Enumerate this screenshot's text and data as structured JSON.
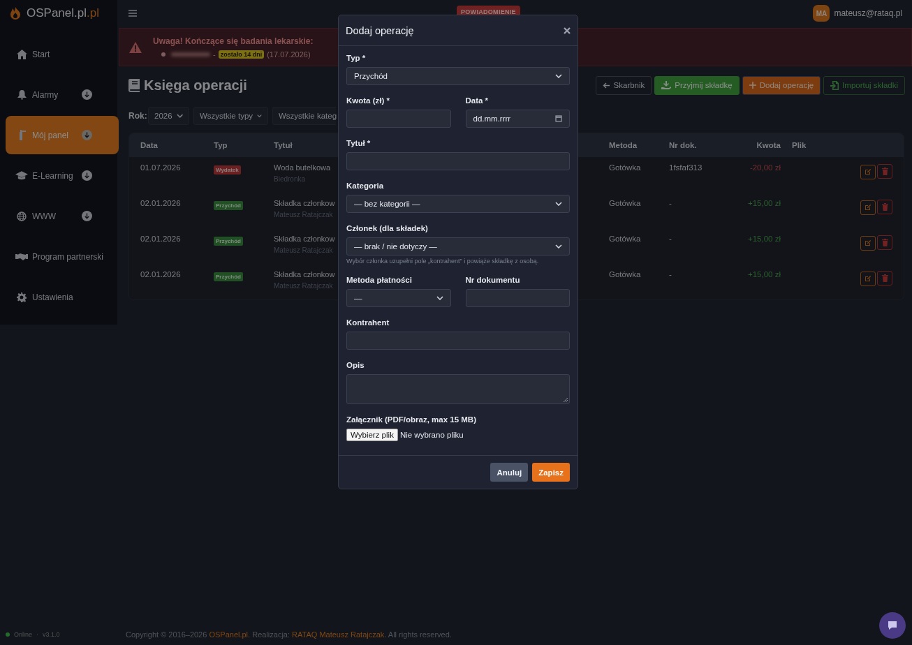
{
  "brand": {
    "name": "OSPanel.pl",
    "suffix": ".pl"
  },
  "sidebar": {
    "items": [
      {
        "label": "Start",
        "has_submenu": false,
        "selected": false
      },
      {
        "label": "Alarmy",
        "has_submenu": true,
        "selected": false
      },
      {
        "label": "Mój panel",
        "has_submenu": true,
        "selected": true
      },
      {
        "label": "E-Learning",
        "has_submenu": true,
        "selected": false
      },
      {
        "label": "WWW",
        "has_submenu": true,
        "selected": false
      },
      {
        "label": "Program partnerski",
        "has_submenu": false,
        "selected": false
      },
      {
        "label": "Ustawienia",
        "has_submenu": false,
        "selected": false
      }
    ],
    "status": "Online",
    "separator": "·",
    "version": "v3.1.0"
  },
  "topbar": {
    "notification": "POWIADOMIENIE",
    "user": {
      "initials": "MA",
      "email": "mateusz@rataq.pl"
    }
  },
  "alert": {
    "title": "Uwaga! Kończące się badania lekarskie:",
    "items": [
      {
        "separator": "-",
        "badge": "zostało 14 dni",
        "date": "(17.07.2026)"
      }
    ]
  },
  "page": {
    "title": "Księga operacji",
    "actions": [
      {
        "label": "Skarbnik",
        "kind": "back"
      },
      {
        "label": "Przyjmij składkę",
        "kind": "success"
      },
      {
        "label": "Dodaj operację",
        "kind": "primary"
      },
      {
        "label": "Importuj składki",
        "kind": "import"
      }
    ]
  },
  "filters": {
    "label": "Rok:",
    "selects": [
      "2026",
      "Wszystkie typy",
      "Wszystkie kateg"
    ]
  },
  "table": {
    "columns": [
      "Data",
      "Typ",
      "Tytuł",
      "Metoda",
      "Nr dok.",
      "Kwota",
      "Plik"
    ],
    "rows": [
      {
        "date": "01.07.2026",
        "type": {
          "label": "Wydatek",
          "kind": "expense"
        },
        "title": "Woda butelkowa",
        "subtitle": "Biedronka",
        "method": "Gotówka",
        "doc": "1fsfaf313",
        "amount": "-20,00 zł"
      },
      {
        "date": "02.01.2026",
        "type": {
          "label": "Przychód",
          "kind": "income"
        },
        "title": "Składka członkow",
        "subtitle": "Mateusz Ratajczak",
        "method": "Gotówka",
        "doc": "-",
        "amount": "+15,00 zł"
      },
      {
        "date": "02.01.2026",
        "type": {
          "label": "Przychód",
          "kind": "income"
        },
        "title": "Składka członkow",
        "subtitle": "Mateusz Ratajczak",
        "method": "Gotówka",
        "doc": "-",
        "amount": "+15,00 zł"
      },
      {
        "date": "02.01.2026",
        "type": {
          "label": "Przychód",
          "kind": "income"
        },
        "title": "Składka członkow",
        "subtitle": "Mateusz Ratajczak",
        "method": "Gotówka",
        "doc": "-",
        "amount": "+15,00 zł"
      }
    ]
  },
  "footer": {
    "copyright": "Copyright © 2016–2026",
    "link1": "OSPanel.pl",
    "middle": ". Realizacja:",
    "link2": "RATAQ Mateusz Ratajczak",
    "end": ". All rights reserved."
  },
  "modal": {
    "title": "Dodaj operację",
    "rows": [
      [
        {
          "kind": "select",
          "label": "Typ *",
          "value": "Przychód"
        }
      ],
      [
        {
          "kind": "input",
          "label": "Kwota (zł) *"
        },
        {
          "kind": "date",
          "label": "Data *",
          "placeholder": "dd.mm.rrrr"
        }
      ],
      [
        {
          "kind": "input",
          "label": "Tytuł *"
        }
      ],
      [
        {
          "kind": "select",
          "label": "Kategoria",
          "value": "— bez kategorii —"
        }
      ],
      [
        {
          "kind": "select",
          "label": "Członek (dla składek)",
          "value": "— brak / nie dotyczy —",
          "hint": "Wybór członka uzupełni pole „kontrahent\" i powiąże składkę z osobą."
        }
      ],
      [
        {
          "kind": "select",
          "label": "Metoda płatności",
          "value": "—"
        },
        {
          "kind": "input",
          "label": "Nr dokumentu"
        }
      ],
      [
        {
          "kind": "input",
          "label": "Kontrahent"
        }
      ],
      [
        {
          "kind": "textarea",
          "label": "Opis"
        }
      ],
      [
        {
          "kind": "file",
          "label": "Załącznik (PDF/obraz, max 15 MB)",
          "button": "Wybierz plik",
          "status": "Nie wybrano pliku"
        }
      ]
    ],
    "buttons": [
      {
        "label": "Anuluj",
        "kind": "secondary"
      },
      {
        "label": "Zapisz",
        "kind": "primary"
      }
    ]
  }
}
